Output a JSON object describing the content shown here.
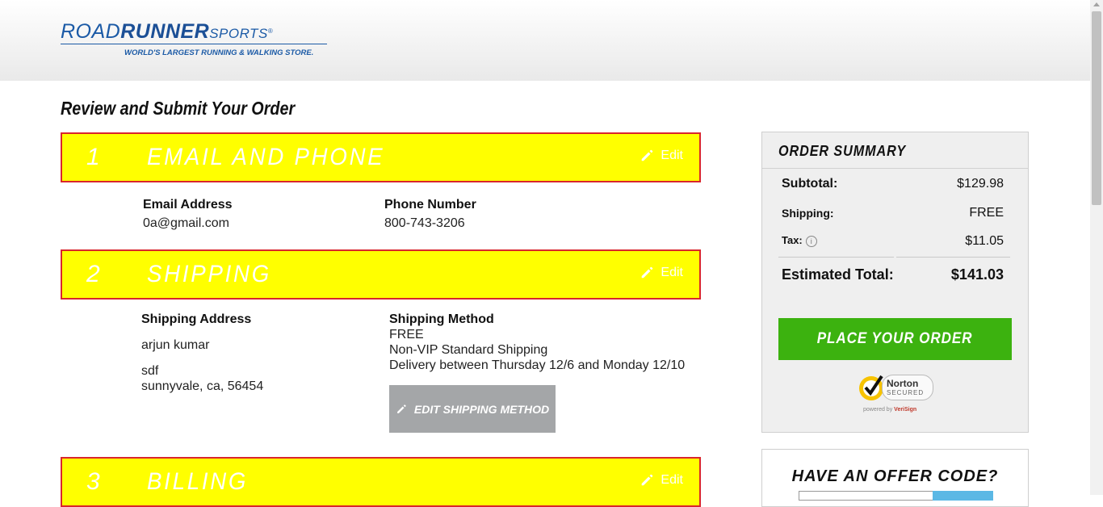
{
  "brand": {
    "road": "ROAD",
    "runner": "RUNNER",
    "sports": "SPORTS",
    "tagline": "WORLD'S LARGEST RUNNING & WALKING STORE.",
    "color": "#1b5aa6"
  },
  "page": {
    "title": "Review and Submit Your Order"
  },
  "sections": [
    {
      "number": "1",
      "title": "EMAIL AND PHONE",
      "edit_label": "Edit"
    },
    {
      "number": "2",
      "title": "SHIPPING",
      "edit_label": "Edit"
    },
    {
      "number": "3",
      "title": "BILLING",
      "edit_label": "Edit"
    }
  ],
  "contact": {
    "email_label": "Email Address",
    "email_value": "0a@gmail.com",
    "phone_label": "Phone Number",
    "phone_value": "800-743-3206"
  },
  "shipping": {
    "address_label": "Shipping Address",
    "name": "arjun kumar",
    "street": "sdf",
    "city_line": "sunnyvale, ca, 56454",
    "method_label": "Shipping Method",
    "method_cost": "FREE",
    "method_name": "Non-VIP Standard Shipping",
    "method_delivery": "Delivery between Thursday 12/6 and Monday 12/10",
    "edit_method_label": "EDIT SHIPPING METHOD"
  },
  "summary": {
    "title": "ORDER SUMMARY",
    "subtotal_label": "Subtotal:",
    "subtotal_value": "$129.98",
    "shipping_label": "Shipping:",
    "shipping_value": "FREE",
    "tax_label": "Tax:",
    "tax_value": "$11.05",
    "total_label": "Estimated Total:",
    "total_value": "$141.03",
    "place_order_label": "PLACE YOUR ORDER",
    "norton_text": "Norton",
    "norton_sub": "SECURED",
    "norton_powered": "powered by",
    "norton_verisign": "VeriSign"
  },
  "offer": {
    "title": "HAVE AN OFFER CODE?"
  },
  "colors": {
    "section_bar": "#ffff00",
    "section_border": "#d9262c",
    "place_order": "#3cb20f",
    "edit_button": "#a4a6a8"
  }
}
